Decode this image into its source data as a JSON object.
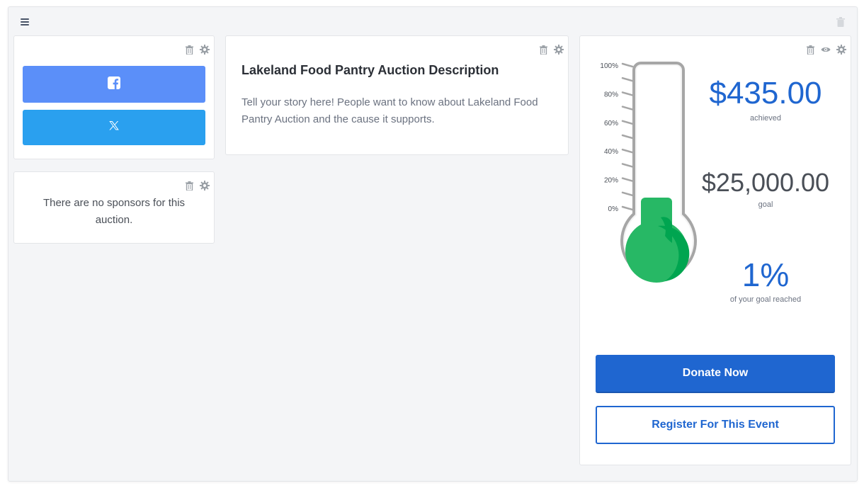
{
  "toolbar": {
    "menu_icon": "hamburger-menu-icon",
    "trash_icon": "trash-icon"
  },
  "share_card": {
    "facebook_icon": "facebook-icon",
    "x_icon": "x-twitter-icon",
    "facebook_color": "#5b8ff9",
    "x_color": "#2aa0ef"
  },
  "sponsors_card": {
    "empty_text": "There are no sponsors for this auction."
  },
  "description_card": {
    "title": "Lakeland Food Pantry Auction Description",
    "body": "Tell your story here! People want to know about Lakeland Food Pantry Auction and the cause it supports."
  },
  "thermometer_card": {
    "scale_labels": [
      "100%",
      "80%",
      "60%",
      "40%",
      "20%",
      "0%"
    ],
    "achieved_amount": "$435.00",
    "achieved_label": "achieved",
    "goal_amount": "$25,000.00",
    "goal_label": "goal",
    "percent": "1%",
    "percent_label": "of your goal reached",
    "progress_fraction": 0.0174,
    "fill_color": "#27b865",
    "accent_color": "#1f66d0",
    "donate_label": "Donate Now",
    "register_label": "Register For This Event"
  }
}
